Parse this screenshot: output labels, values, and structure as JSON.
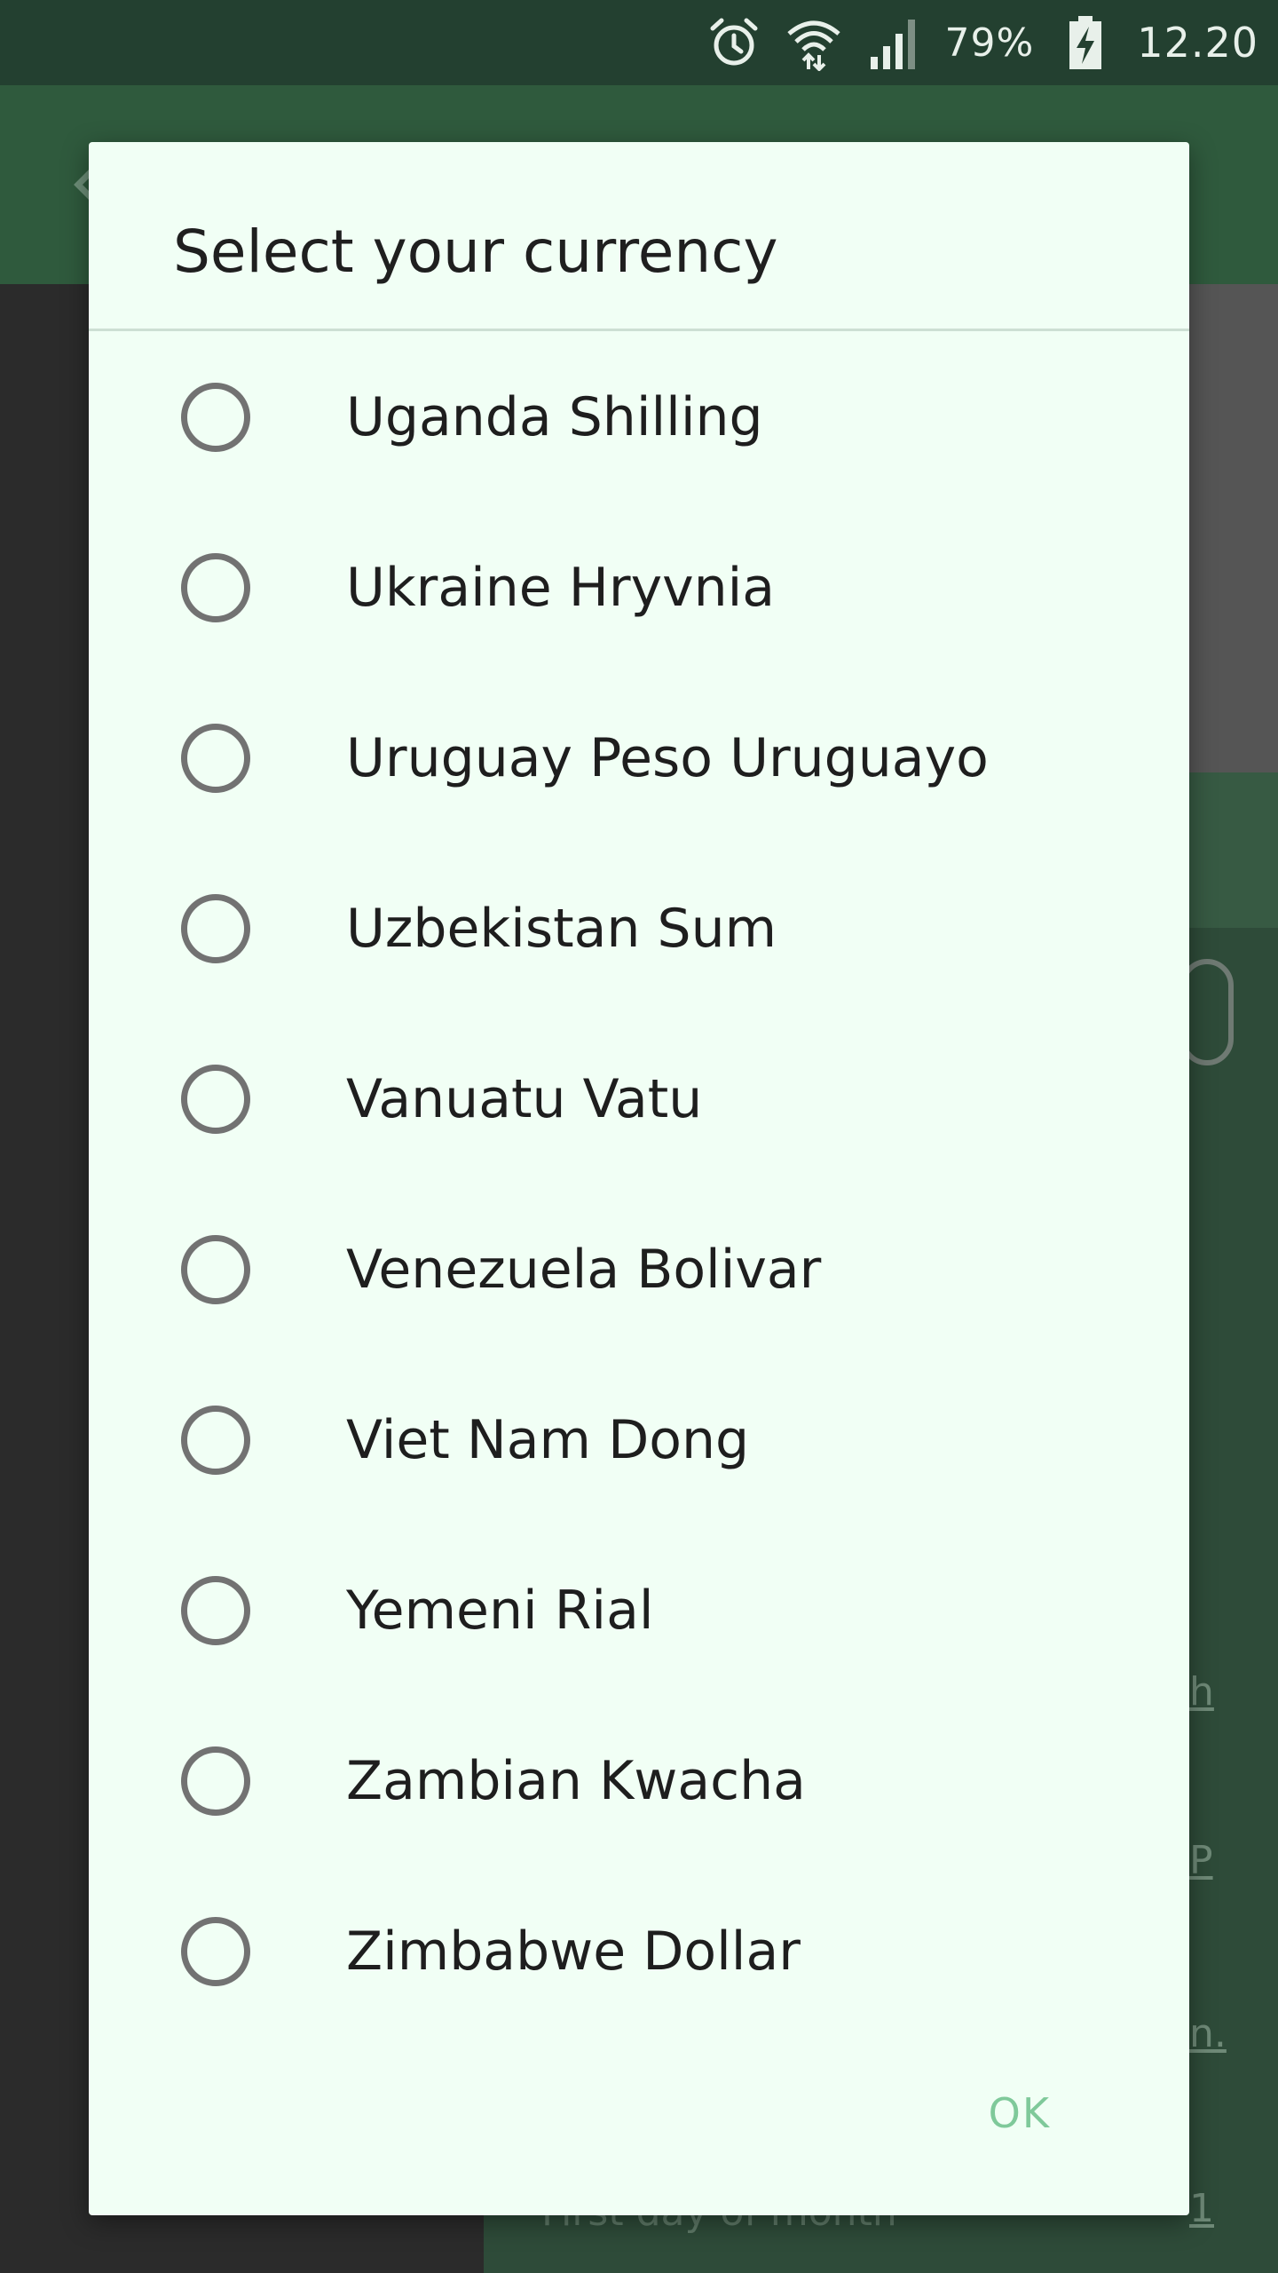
{
  "status_bar": {
    "battery_percent": "79%",
    "time": "12.20",
    "icons": [
      "alarm-icon",
      "wifi-icon",
      "signal-icon",
      "battery-charging-icon"
    ]
  },
  "dialog": {
    "title": "Select your currency",
    "options": [
      {
        "label": "Uganda Shilling",
        "selected": false
      },
      {
        "label": "Ukraine Hryvnia",
        "selected": false
      },
      {
        "label": "Uruguay Peso Uruguayo",
        "selected": false
      },
      {
        "label": "Uzbekistan Sum",
        "selected": false
      },
      {
        "label": "Vanuatu Vatu",
        "selected": false
      },
      {
        "label": "Venezuela Bolivar",
        "selected": false
      },
      {
        "label": "Viet Nam Dong",
        "selected": false
      },
      {
        "label": "Yemeni Rial",
        "selected": false
      },
      {
        "label": "Zambian Kwacha",
        "selected": false
      },
      {
        "label": "Zimbabwe Dollar",
        "selected": false
      }
    ],
    "ok_label": "OK"
  },
  "background": {
    "link_fragments": [
      "h",
      "P",
      "n.",
      "1"
    ],
    "bottom_text": "First day of month"
  },
  "colors": {
    "status_bar": "#234030",
    "app_bar": "#2f5a3d",
    "dialog_bg": "#f1fff5",
    "accent": "#7fc99a",
    "radio_border": "#727272"
  }
}
